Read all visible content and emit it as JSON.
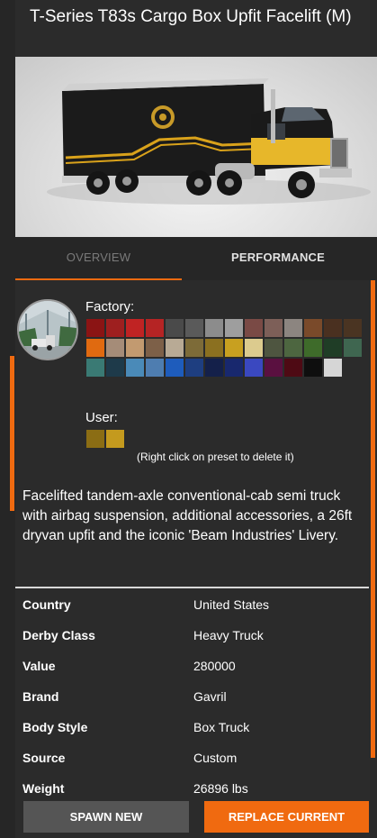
{
  "header": {
    "title": "T-Series T83s Cargo Box Upfit Facelift (M)"
  },
  "tabs": {
    "overview": "OVERVIEW",
    "performance": "PERFORMANCE"
  },
  "paint": {
    "factory_label": "Factory:",
    "user_label": "User:",
    "hint": "(Right click on preset to delete it)",
    "factory_colors": [
      "#8b1414",
      "#9e1f1f",
      "#c02323",
      "#b52424",
      "#4a4a4a",
      "#5a5a5a",
      "#8c8c8c",
      "#9e9e9e",
      "#7a4a45",
      "#7d5f58",
      "#8c8580",
      "#7a4a2a",
      "#4a3020",
      "#4a3422",
      "#e06a10",
      "#a58c78",
      "#c29a70",
      "#7d6048",
      "#b8aa95",
      "#7d6b38",
      "#8b7020",
      "#c8a020",
      "#dccb8e",
      "#4e5540",
      "#4d6640",
      "#3e6b2a",
      "#1f3d26",
      "#3f6650",
      "#3a7a74",
      "#1e3a4a",
      "#4a8ab8",
      "#4e7db0",
      "#1e5cbc",
      "#1e3e80",
      "#14204a",
      "#18286e",
      "#3a48c0",
      "#5a1040",
      "#4e0a14",
      "#0e0e0e",
      "#d6d6d6"
    ],
    "user_colors": [
      "#8b6d14",
      "#c49a1e"
    ]
  },
  "description": "Facelifted tandem-axle conventional-cab semi truck with airbag suspension, additional accessories, a 26ft dryvan upfit and the iconic 'Beam Industries' Livery.",
  "specs": [
    {
      "key": "Country",
      "value": "United States"
    },
    {
      "key": "Derby Class",
      "value": "Heavy Truck"
    },
    {
      "key": "Value",
      "value": "280000"
    },
    {
      "key": "Brand",
      "value": "Gavril"
    },
    {
      "key": "Body Style",
      "value": "Box Truck"
    },
    {
      "key": "Source",
      "value": "Custom"
    },
    {
      "key": "Weight",
      "value": "26896 lbs"
    }
  ],
  "buttons": {
    "spawn": "SPAWN NEW",
    "replace": "REPLACE CURRENT"
  },
  "colors": {
    "accent": "#f06a10",
    "spawn_bg": "#555555"
  }
}
